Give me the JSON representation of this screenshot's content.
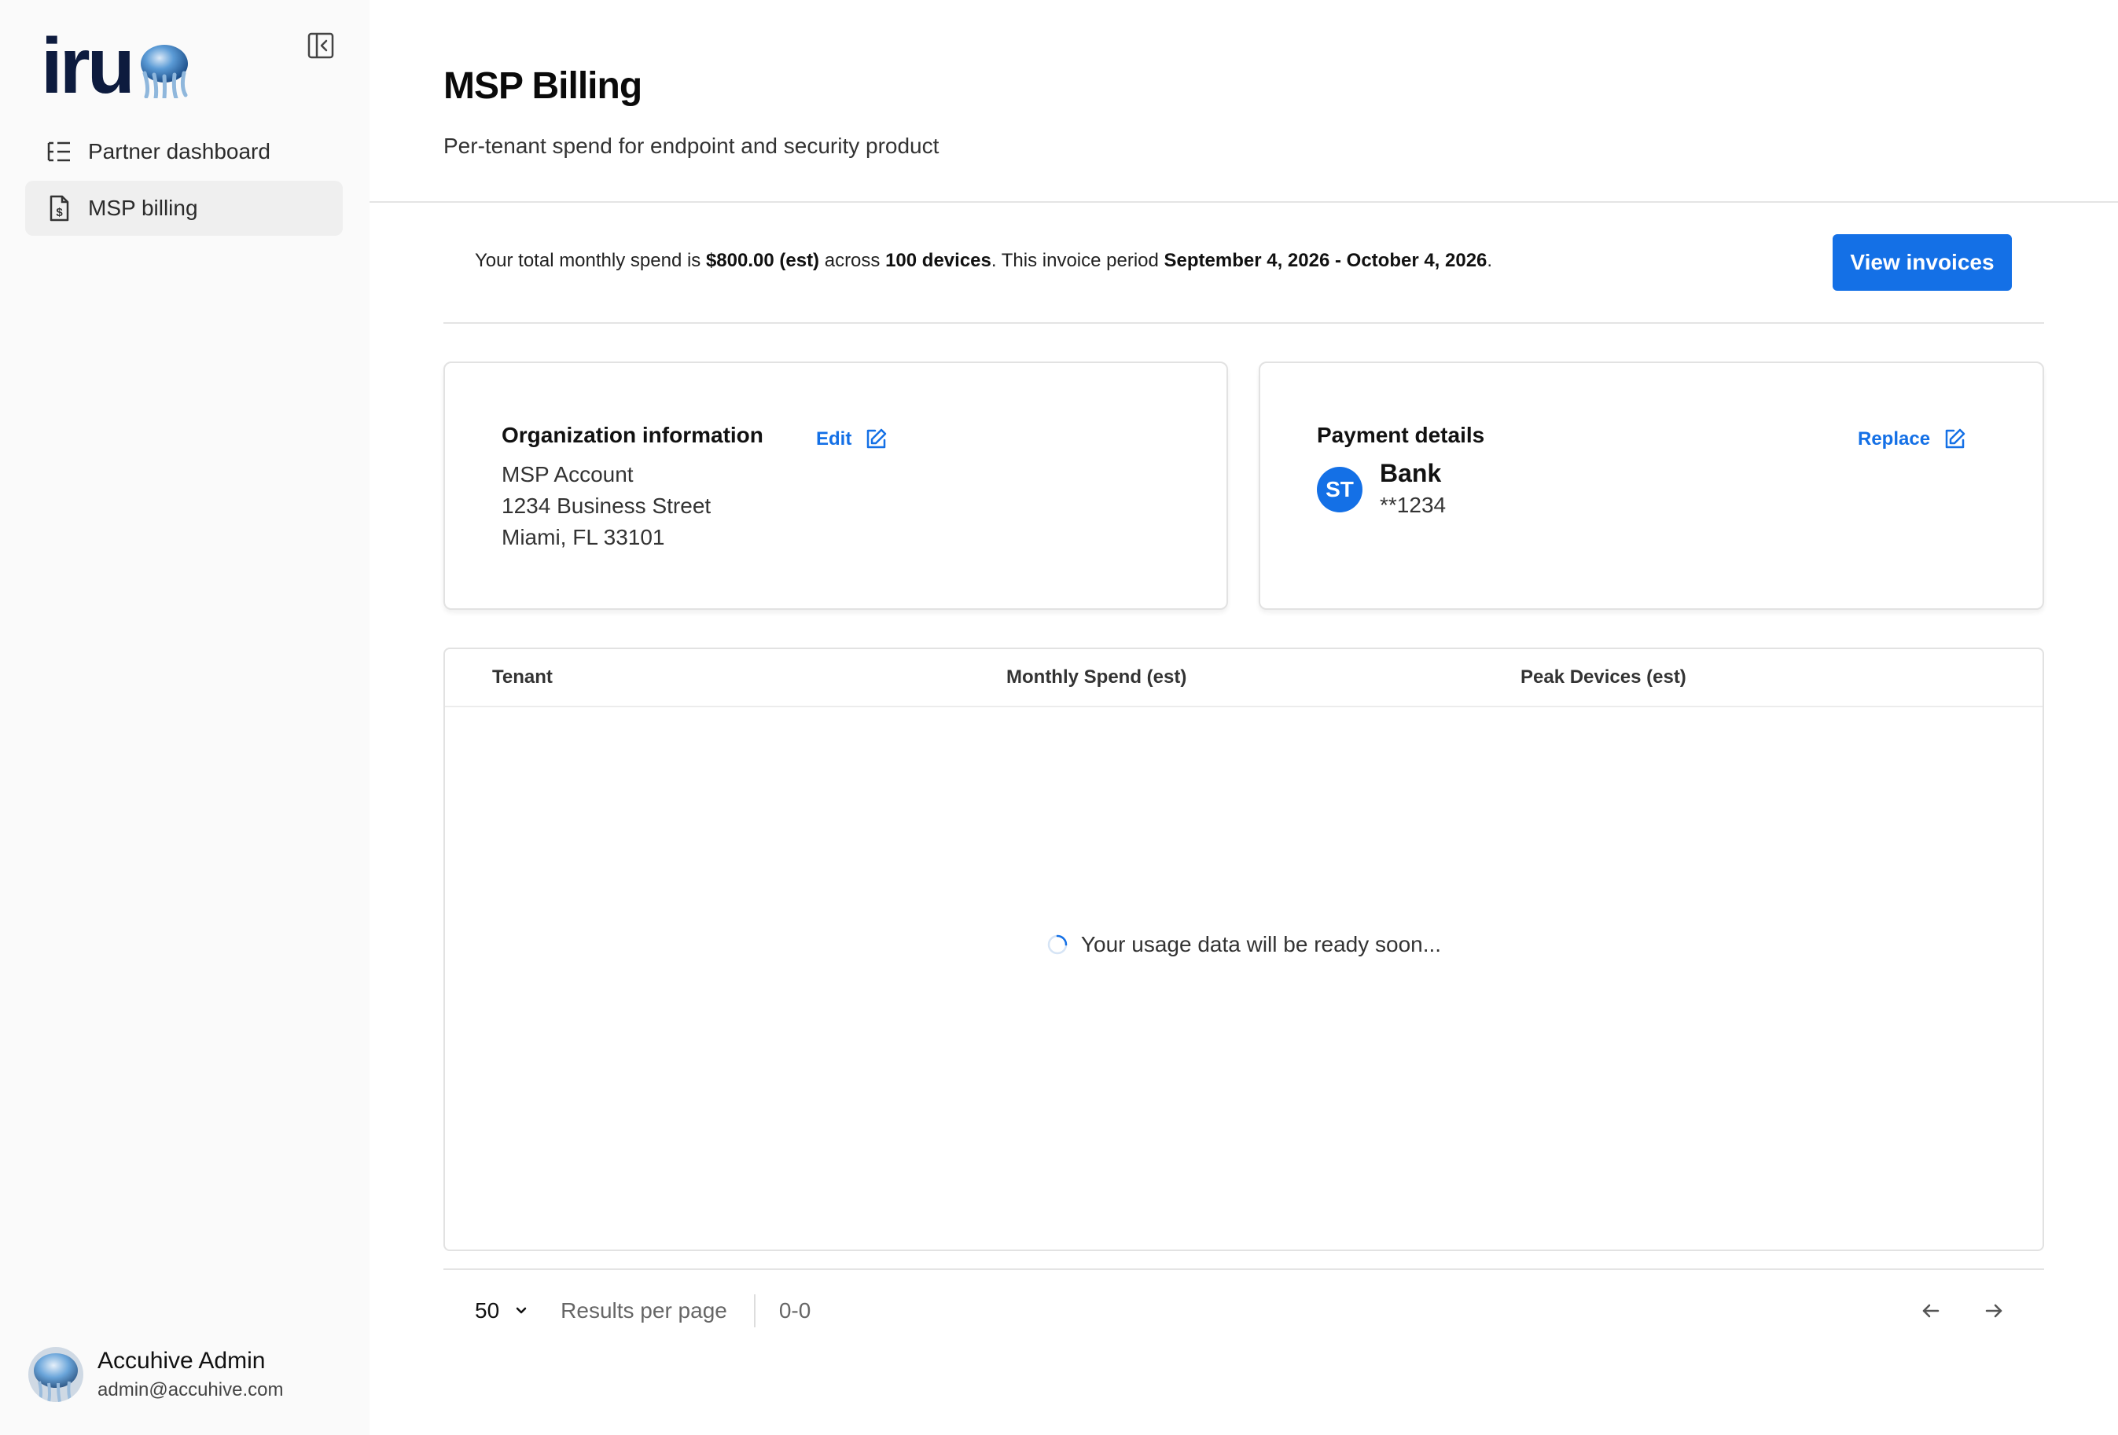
{
  "brand": {
    "logo_text": "iru"
  },
  "sidebar": {
    "items": [
      {
        "label": "Partner dashboard",
        "icon": "list-tree-icon",
        "active": false
      },
      {
        "label": "MSP billing",
        "icon": "invoice-dollar-icon",
        "active": true
      }
    ],
    "user": {
      "name": "Accuhive Admin",
      "email": "admin@accuhive.com"
    }
  },
  "header": {
    "title": "MSP Billing",
    "subtitle": "Per-tenant spend for endpoint and security product"
  },
  "summary": {
    "prefix": "Your total monthly spend is ",
    "amount": "$800.00 (est)",
    "mid1": " across ",
    "devices": "100 devices",
    "mid2": ". This invoice period ",
    "period": "September 4, 2026 - October 4, 2026",
    "suffix": ".",
    "view_invoices_label": "View invoices"
  },
  "org_card": {
    "title": "Organization information",
    "edit_label": "Edit",
    "lines": [
      "MSP Account",
      "1234 Business Street",
      "Miami, FL 33101"
    ]
  },
  "payment_card": {
    "title": "Payment details",
    "replace_label": "Replace",
    "badge": "ST",
    "method": "Bank",
    "account": "**1234"
  },
  "table": {
    "columns": [
      "Tenant",
      "Monthly Spend (est)",
      "Peak Devices (est)"
    ],
    "loading_text": "Your usage data will be ready soon..."
  },
  "pagination": {
    "per_page": "50",
    "per_page_label": "Results per page",
    "range": "0-0"
  },
  "colors": {
    "accent": "#1470e6",
    "logo": "#0d1b3e"
  }
}
